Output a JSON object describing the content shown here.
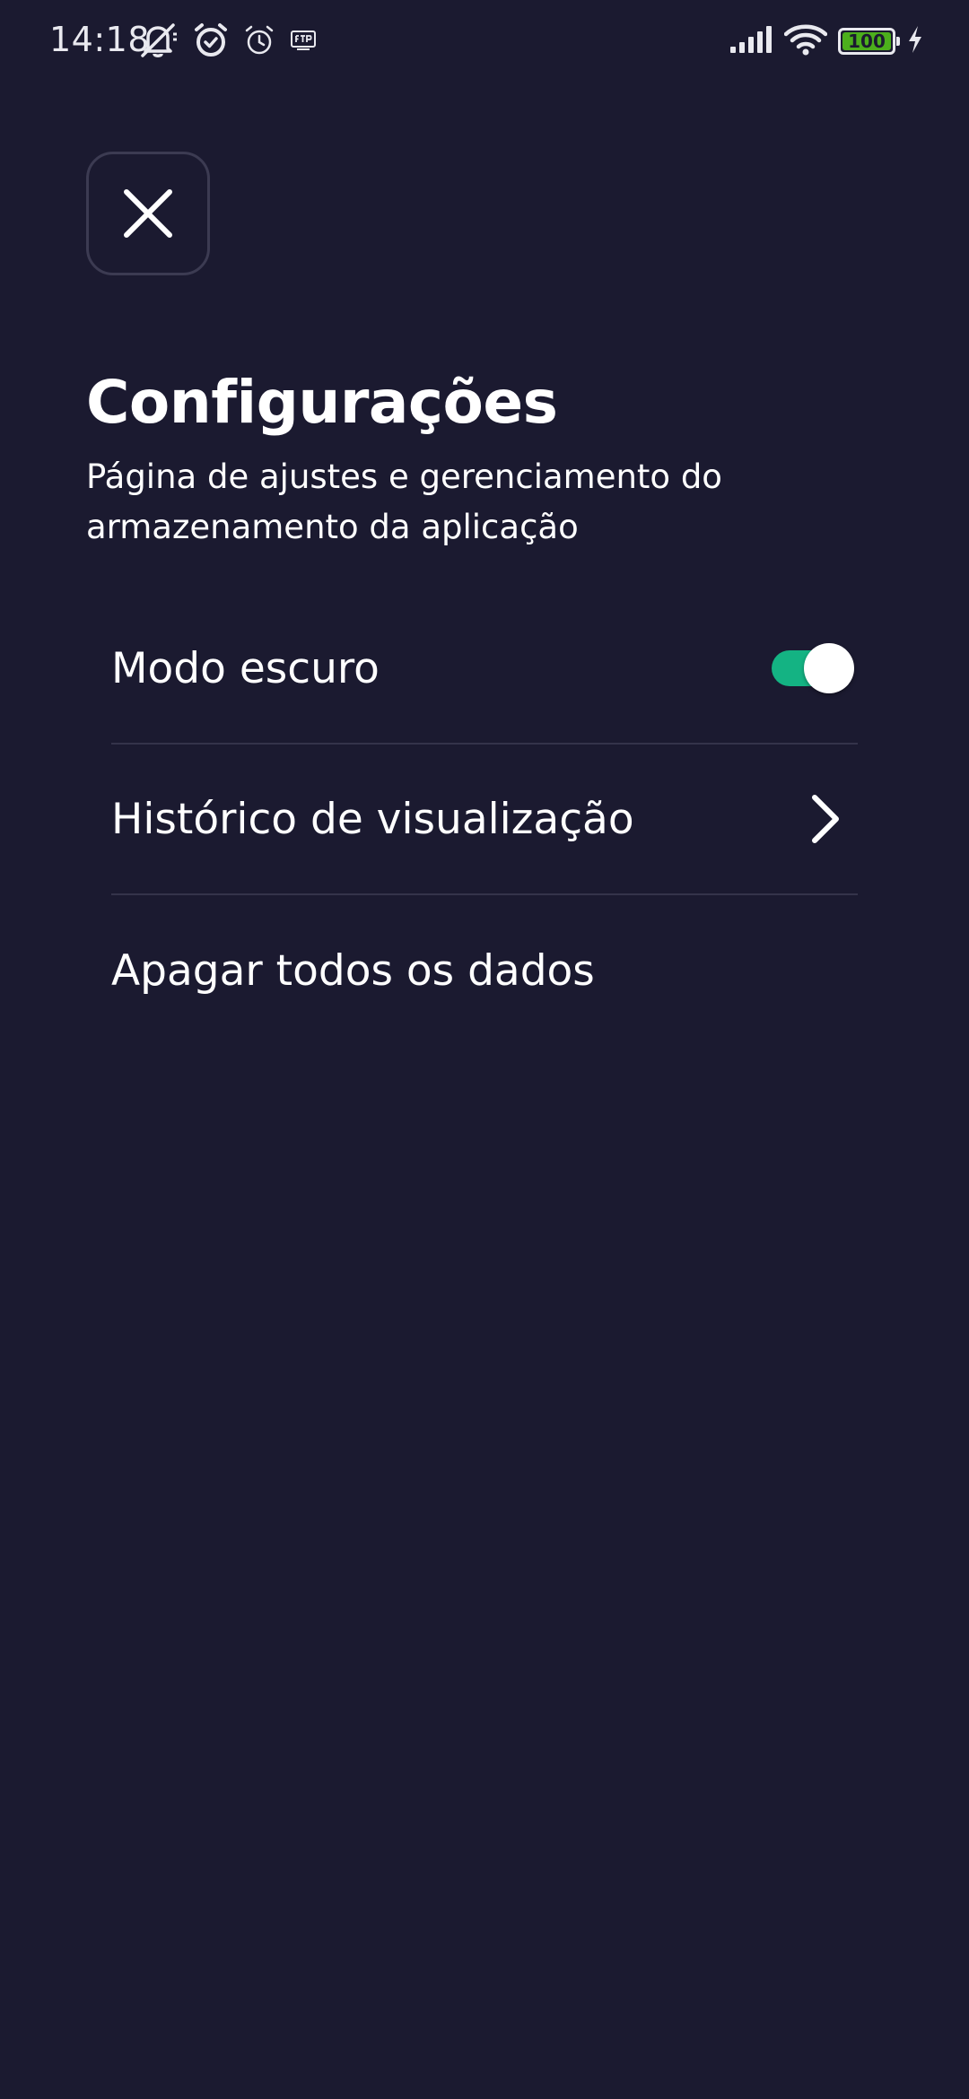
{
  "status_bar": {
    "time": "14:18",
    "battery_level": "100",
    "left_icons": [
      "bell-off-icon",
      "alarm-icon",
      "alarm-outline-icon",
      "ftp-icon"
    ],
    "right_icons": [
      "signal-icon",
      "wifi-icon",
      "battery-icon",
      "charging-icon"
    ]
  },
  "header": {
    "close_icon": "close-icon",
    "title": "Configurações",
    "subtitle": "Página de ajustes e gerenciamento do armazenamento da aplicação"
  },
  "settings": {
    "items": [
      {
        "label": "Modo escuro",
        "control": "toggle",
        "enabled": true
      },
      {
        "label": "Histórico de visualização",
        "control": "chevron-right-icon"
      },
      {
        "label": "Apagar todos os dados",
        "control": "none"
      }
    ]
  },
  "colors": {
    "background": "#1b1a30",
    "text": "#ffffff",
    "toggle_on": "#14b383",
    "divider": "#34334a",
    "battery_fill": "#4caf1c"
  }
}
